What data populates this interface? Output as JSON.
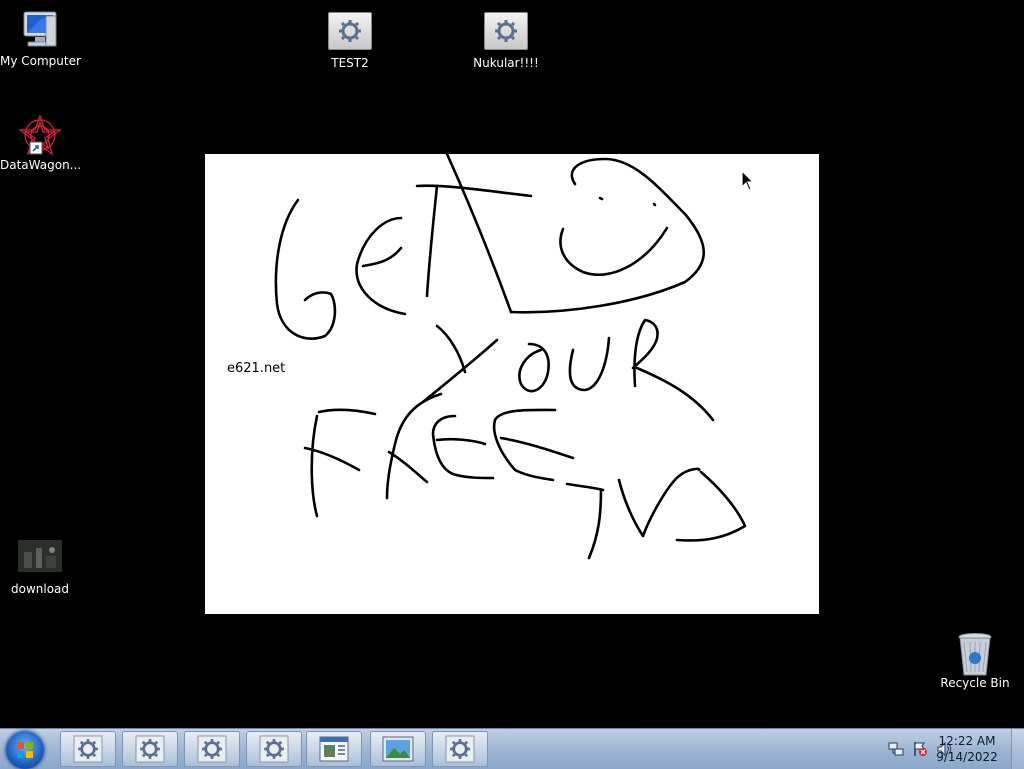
{
  "desktop_icons": [
    {
      "label": "My Computer",
      "icon": "computer-icon"
    },
    {
      "label": "TEST2",
      "icon": "application-gear-icon"
    },
    {
      "label": "Nukular!!!!",
      "icon": "application-gear-icon"
    },
    {
      "label": "DataWagon...",
      "icon": "shortcut-star-icon"
    },
    {
      "label": "download",
      "icon": "video-thumbnail-icon"
    },
    {
      "label": "Recycle Bin",
      "icon": "recycle-bin-icon"
    }
  ],
  "image_window": {
    "caption": "e621.net",
    "drawing_text": "GET YOUR FREE TVS"
  },
  "taskbar": {
    "start_label": "Start",
    "buttons": [
      {
        "icon": "application-gear-icon"
      },
      {
        "icon": "application-gear-icon"
      },
      {
        "icon": "application-gear-icon"
      },
      {
        "icon": "application-gear-icon"
      },
      {
        "icon": "window-app-icon"
      },
      {
        "icon": "picture-viewer-icon"
      },
      {
        "icon": "application-gear-icon"
      }
    ],
    "clock": {
      "time": "12:22 AM",
      "date": "9/14/2022"
    }
  },
  "colors": {
    "taskbar": "#a8bdd8",
    "desktop": "#000000",
    "accent": "#1c5fc2"
  }
}
